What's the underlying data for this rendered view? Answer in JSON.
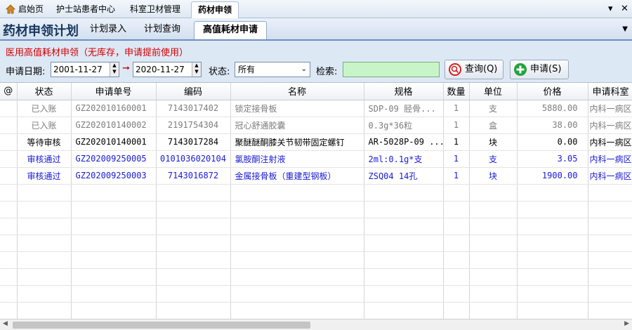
{
  "top_tabs": [
    {
      "label": "启始页"
    },
    {
      "label": "护士站患者中心"
    },
    {
      "label": "科室卫材管理"
    },
    {
      "label": "药材申领"
    }
  ],
  "window_controls": {
    "dropdown": "▾",
    "close": "✕"
  },
  "app_title": "药材申领计划",
  "nav_tabs": [
    {
      "label": "计划录入"
    },
    {
      "label": "计划查询"
    },
    {
      "label": "高值耗材申请"
    }
  ],
  "notice": "医用高值耗材申领（无库存，申请提前使用）",
  "filters": {
    "date_label": "申请日期:",
    "date_from": "2001-11-27",
    "date_to": "2020-11-27",
    "status_label": "状态:",
    "status_value": "所有",
    "search_label": "检索:",
    "search_value": ""
  },
  "buttons": {
    "query": "查询(Q)",
    "apply": "申请(S)"
  },
  "table": {
    "headers": [
      "@",
      "状态",
      "申请单号",
      "编码",
      "名称",
      "规格",
      "数量",
      "单位",
      "价格",
      "申请科室"
    ],
    "rows": [
      {
        "style": "gray",
        "cells": [
          "",
          "已入账",
          "GZ202010160001",
          "7143017402",
          "锁定接骨板",
          "SDP-09 胫骨...",
          "1",
          "支",
          "5880.00",
          "内科一病区"
        ]
      },
      {
        "style": "gray",
        "cells": [
          "",
          "已入账",
          "GZ202010140002",
          "2191754304",
          "冠心舒通胶囊",
          "0.3g*36粒",
          "1",
          "盒",
          "38.00",
          "内科一病区"
        ]
      },
      {
        "style": "black",
        "cells": [
          "",
          "等待审核",
          "GZ202010140001",
          "7143017284",
          "聚醚醚酮膝关节韧带固定螺钉",
          "AR-5028P-09 ...",
          "1",
          "块",
          "0.00",
          "内科一病区"
        ]
      },
      {
        "style": "blue",
        "cells": [
          "",
          "审核通过",
          "GZ202009250005",
          "0101036020104",
          "氯胺酮注射液",
          "2ml:0.1g*支",
          "1",
          "支",
          "3.05",
          "内科一病区"
        ]
      },
      {
        "style": "blue",
        "cells": [
          "",
          "审核通过",
          "GZ202009250003",
          "7143016872",
          "金属接骨板（重建型钢板）",
          "ZSQ04 14孔",
          "1",
          "块",
          "1900.00",
          "内科一病区"
        ]
      }
    ],
    "empty_rows": 8
  }
}
